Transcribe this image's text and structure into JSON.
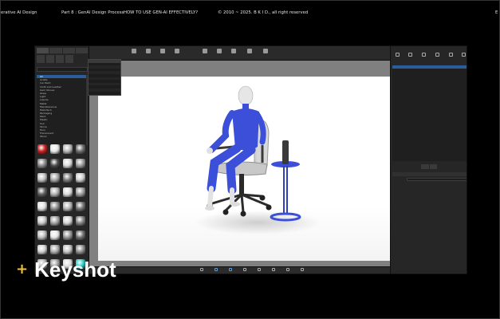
{
  "header": {
    "course": "erative AI Design",
    "part": "Part 8 : GenAI Design Process",
    "topic": "HOW TO USE GEN-AI EFFECTIVELY?",
    "copyright": "© 2010 ~ 2025. B K I D., all right reserved",
    "edge_mark": "E"
  },
  "overlay": {
    "plus": "+",
    "title": "Keyshot"
  },
  "colors": {
    "accent_yellow": "#f0c040",
    "selection_blue": "#2b5d9c",
    "figure_blue": "#3b4fd8"
  },
  "left_panel": {
    "tree_items": [
      "All",
      "Axalta",
      "Car Paint",
      "Cloth and Leather",
      "Gem Stones",
      "Glass",
      "Light",
      "Liquids",
      "Metal",
      "Miscellaneous",
      "Mold-Tech",
      "Packaging",
      "Paint",
      "Plastic",
      "Soil",
      "Stone",
      "Toon",
      "Translucent",
      "Wood"
    ],
    "materials": [
      {
        "name": "",
        "color": "#cc2020"
      },
      {
        "name": "",
        "color": "#e8e8e8"
      },
      {
        "name": "",
        "color": "#b8b8b8"
      },
      {
        "name": "",
        "color": "#6c6c6c"
      },
      {
        "name": "",
        "color": "#8a8a8a"
      },
      {
        "name": "",
        "color": "#4a4a4a"
      },
      {
        "name": "",
        "color": "#d9d9d9"
      },
      {
        "name": "",
        "color": "#9a9a9a"
      },
      {
        "name": "",
        "color": "#c0c0c0"
      },
      {
        "name": "",
        "color": "#a8a8a8"
      },
      {
        "name": "",
        "color": "#7b7b7b"
      },
      {
        "name": "",
        "color": "#cdcdcd"
      },
      {
        "name": "",
        "color": "#5e5e5e"
      },
      {
        "name": "",
        "color": "#b0b0b0"
      },
      {
        "name": "",
        "color": "#dadada"
      },
      {
        "name": "",
        "color": "#9c9c9c"
      },
      {
        "name": "",
        "color": "#e0e0e0"
      },
      {
        "name": "",
        "color": "#8d8d8d"
      },
      {
        "name": "",
        "color": "#b5b5b5"
      },
      {
        "name": "",
        "color": "#747474"
      },
      {
        "name": "",
        "color": "#c9c9c9"
      },
      {
        "name": "",
        "color": "#a3a3a3"
      },
      {
        "name": "",
        "color": "#d5d5d5"
      },
      {
        "name": "",
        "color": "#838383"
      },
      {
        "name": "",
        "color": "#bdbdbd"
      },
      {
        "name": "",
        "color": "#e6e6e6"
      },
      {
        "name": "",
        "color": "#979797"
      },
      {
        "name": "",
        "color": "#6f6f6f"
      },
      {
        "name": "",
        "color": "#d2d2d2"
      },
      {
        "name": "",
        "color": "#ababab"
      },
      {
        "name": "",
        "color": "#c4c4c4"
      },
      {
        "name": "",
        "color": "#8f8f8f"
      },
      {
        "name": "",
        "color": "#b9b9b9"
      },
      {
        "name": "",
        "color": "#9f9f9f"
      },
      {
        "name": "",
        "color": "#dedede"
      },
      {
        "name": "",
        "color": "#30d0c8"
      }
    ]
  }
}
